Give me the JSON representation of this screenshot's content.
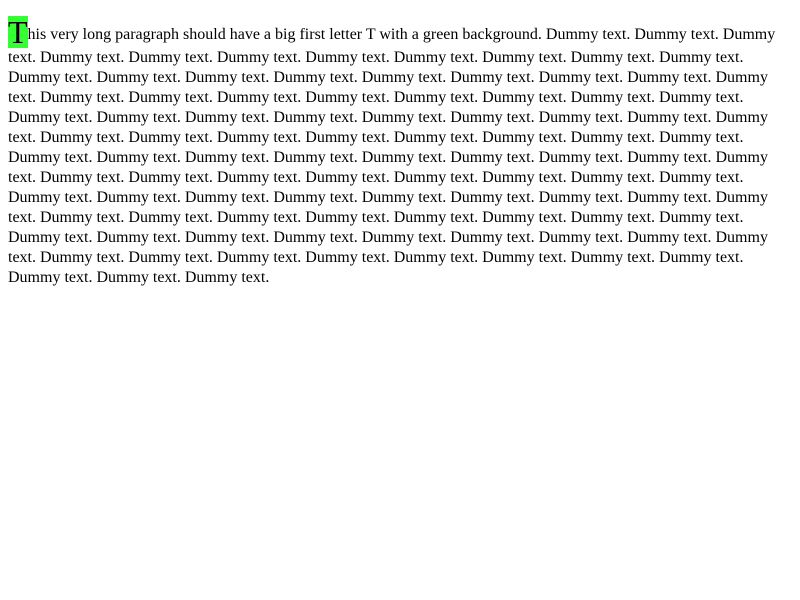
{
  "document": {
    "first_letter": "T",
    "first_letter_background": "#33ff33",
    "paragraph_rest": "his very long paragraph should have a big first letter T with a green background. Dummy text. Dummy text. Dummy text. Dummy text. Dummy text. Dummy text. Dummy text. Dummy text. Dummy text. Dummy text. Dummy text. Dummy text. Dummy text. Dummy text. Dummy text. Dummy text. Dummy text. Dummy text. Dummy text. Dummy text. Dummy text. Dummy text. Dummy text. Dummy text. Dummy text. Dummy text. Dummy text. Dummy text. Dummy text. Dummy text. Dummy text. Dummy text. Dummy text. Dummy text. Dummy text. Dummy text. Dummy text. Dummy text. Dummy text. Dummy text. Dummy text. Dummy text. Dummy text. Dummy text. Dummy text. Dummy text. Dummy text. Dummy text. Dummy text. Dummy text. Dummy text. Dummy text. Dummy text. Dummy text. Dummy text. Dummy text. Dummy text. Dummy text. Dummy text. Dummy text. Dummy text. Dummy text. Dummy text. Dummy text. Dummy text. Dummy text. Dummy text. Dummy text. Dummy text. Dummy text. Dummy text. Dummy text. Dummy text. Dummy text. Dummy text. Dummy text. Dummy text. Dummy text. Dummy text. Dummy text. Dummy text. Dummy text. Dummy text. Dummy text. Dummy text. Dummy text. Dummy text. Dummy text. Dummy text. Dummy text. Dummy text. Dummy text. Dummy text. Dummy text. Dummy text. Dummy text. Dummy text. Dummy text. Dummy text."
  }
}
